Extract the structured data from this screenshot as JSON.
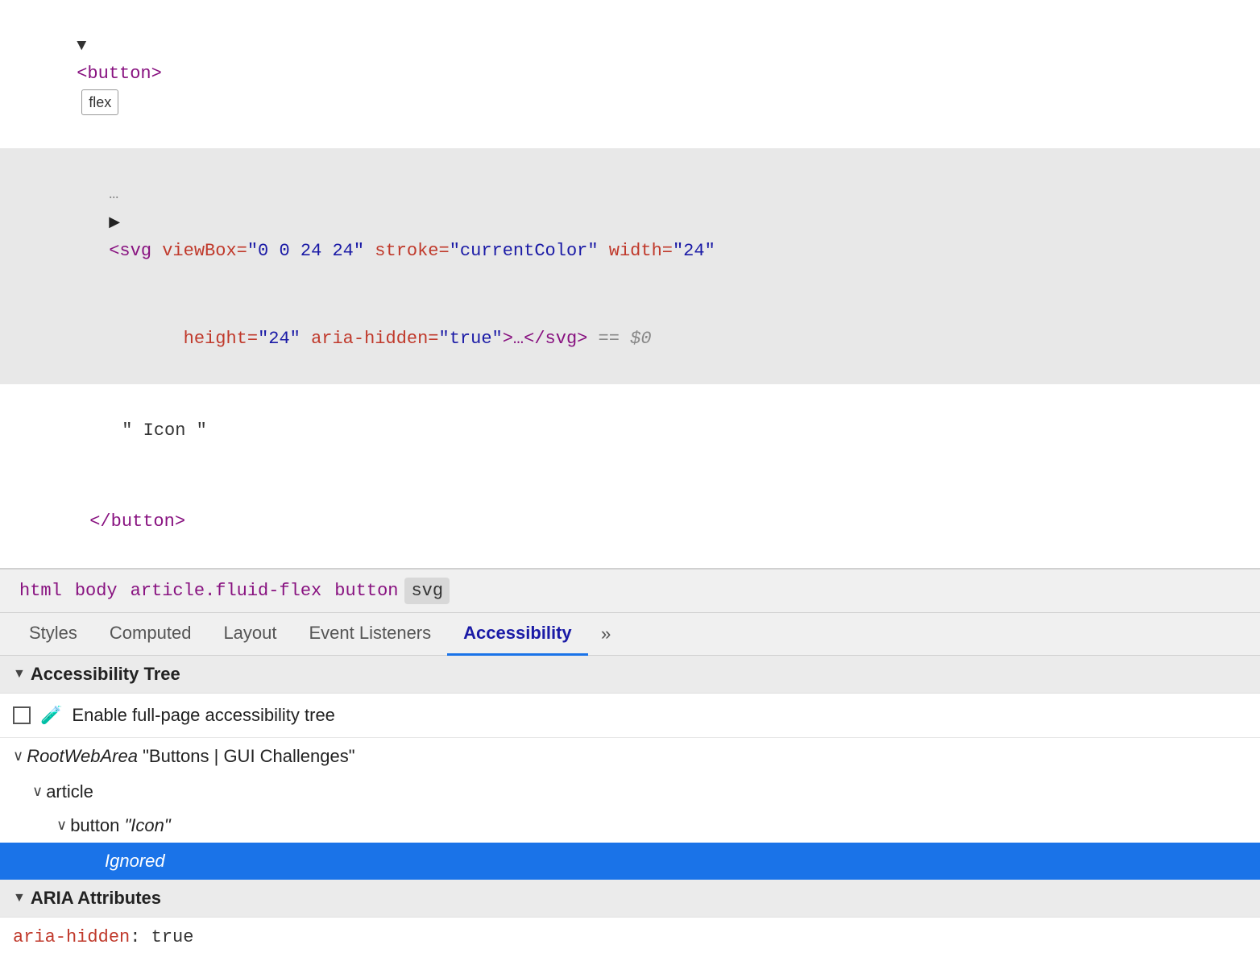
{
  "dom": {
    "button_open_tag": "<button>",
    "flex_badge": "flex",
    "svg_line": "<svg viewBox=\"0 0 24 24\" stroke=\"currentColor\" width=\"24\"",
    "height_line": "height=\"24\" aria-hidden=\"true\">…</svg>",
    "dollar_sign": "== $0",
    "icon_text": "\" Icon \"",
    "button_close": "</button>",
    "ellipsis": "…"
  },
  "breadcrumb": {
    "items": [
      {
        "label": "html",
        "active": false
      },
      {
        "label": "body",
        "active": false
      },
      {
        "label": "article.fluid-flex",
        "active": false
      },
      {
        "label": "button",
        "active": false
      },
      {
        "label": "svg",
        "active": true
      }
    ]
  },
  "tabs": {
    "items": [
      {
        "label": "Styles",
        "active": false
      },
      {
        "label": "Computed",
        "active": false
      },
      {
        "label": "Layout",
        "active": false
      },
      {
        "label": "Event Listeners",
        "active": false
      },
      {
        "label": "Accessibility",
        "active": true
      }
    ],
    "more_label": "»"
  },
  "accessibility_tree": {
    "section_title": "Accessibility Tree",
    "enable_label": "Enable full-page accessibility tree",
    "root_web_area_label": "RootWebArea",
    "root_web_area_value": "\"Buttons | GUI Challenges\"",
    "article_label": "article",
    "button_label": "button",
    "button_value": "\"Icon\"",
    "ignored_label": "Ignored"
  },
  "aria_attributes": {
    "section_title": "ARIA Attributes",
    "key": "aria-hidden",
    "colon": ":",
    "value": "true"
  },
  "colors": {
    "active_tab_underline": "#1a73e8",
    "selected_row_bg": "#1a73e8",
    "tag_purple": "#881280",
    "attr_orange": "#c0392b",
    "attr_value_blue": "#1a1aa6"
  }
}
